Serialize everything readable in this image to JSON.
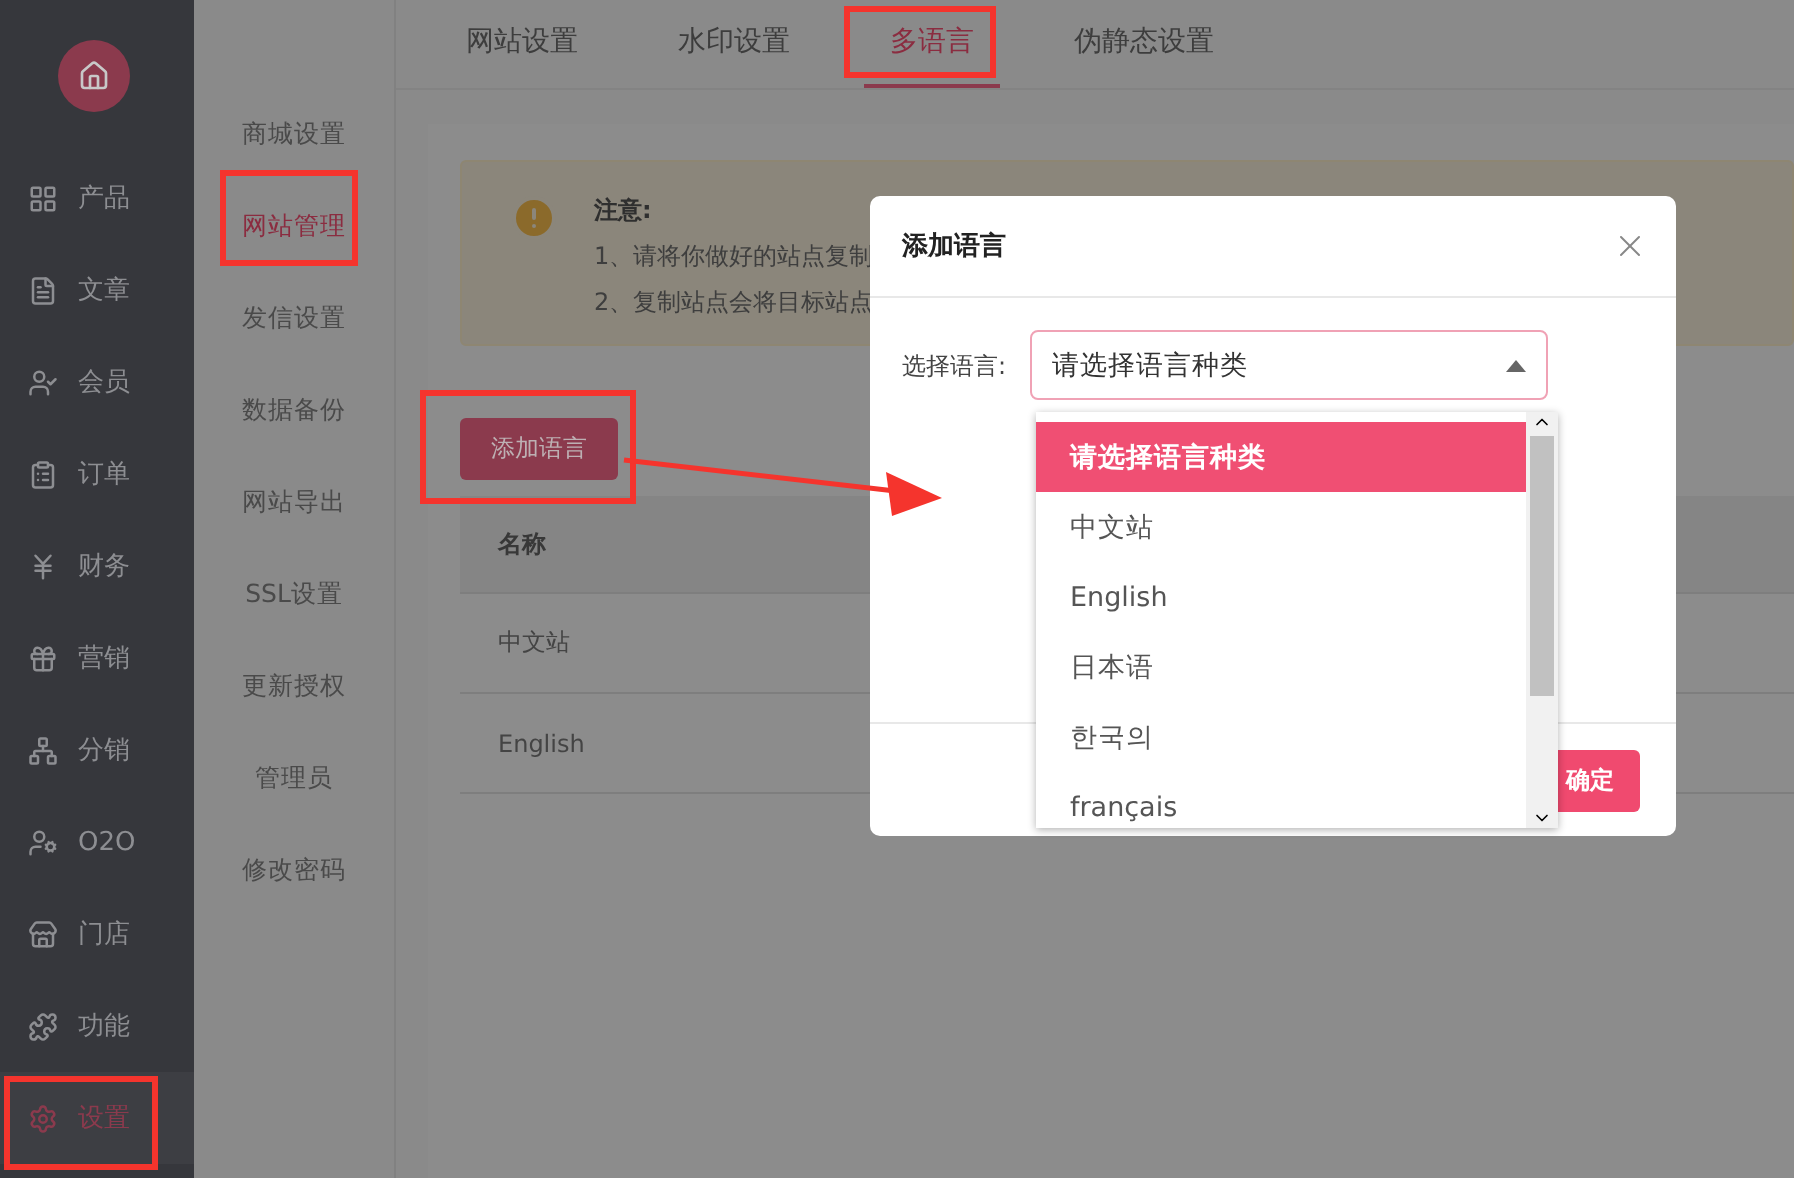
{
  "sidebar": {
    "items": [
      {
        "label": "产品",
        "selected": false
      },
      {
        "label": "文章",
        "selected": false
      },
      {
        "label": "会员",
        "selected": false
      },
      {
        "label": "订单",
        "selected": false
      },
      {
        "label": "财务",
        "selected": false
      },
      {
        "label": "营销",
        "selected": false
      },
      {
        "label": "分销",
        "selected": false
      },
      {
        "label": "O2O",
        "selected": false
      },
      {
        "label": "门店",
        "selected": false
      },
      {
        "label": "功能",
        "selected": false
      },
      {
        "label": "设置",
        "selected": true
      }
    ]
  },
  "submenu": {
    "items": [
      {
        "label": "商城设置",
        "selected": false
      },
      {
        "label": "网站管理",
        "selected": true
      },
      {
        "label": "发信设置",
        "selected": false
      },
      {
        "label": "数据备份",
        "selected": false
      },
      {
        "label": "网站导出",
        "selected": false
      },
      {
        "label": "SSL设置",
        "selected": false
      },
      {
        "label": "更新授权",
        "selected": false
      },
      {
        "label": "管理员",
        "selected": false
      },
      {
        "label": "修改密码",
        "selected": false
      }
    ]
  },
  "tabs": [
    {
      "label": "网站设置",
      "selected": false
    },
    {
      "label": "水印设置",
      "selected": false
    },
    {
      "label": "多语言",
      "selected": true
    },
    {
      "label": "伪静态设置",
      "selected": false
    }
  ],
  "notice": {
    "title": "注意:",
    "lines": [
      "1、请将你做好的站点复制",
      "2、复制站点会将目标站点"
    ]
  },
  "add_button": "添加语言",
  "table": {
    "columns": [
      "名称"
    ],
    "rows": [
      [
        "中文站"
      ],
      [
        "English"
      ]
    ]
  },
  "dialog": {
    "title": "添加语言",
    "field_label": "选择语言:",
    "select_value": "请选择语言种类",
    "options": [
      {
        "label": "请选择语言种类",
        "selected": true
      },
      {
        "label": "中文站",
        "selected": false
      },
      {
        "label": "English",
        "selected": false
      },
      {
        "label": "日本语",
        "selected": false
      },
      {
        "label": "한국의",
        "selected": false
      },
      {
        "label": "français",
        "selected": false
      }
    ],
    "confirm_button": "确定"
  }
}
